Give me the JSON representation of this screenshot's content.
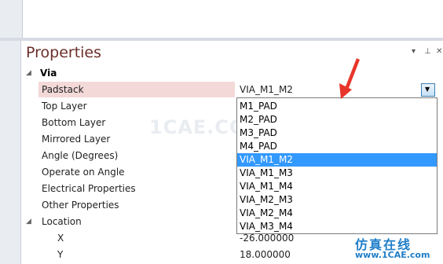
{
  "panel": {
    "title": "Properties"
  },
  "category": {
    "label": "Via"
  },
  "rows": [
    {
      "name": "Padstack",
      "value": "VIA_M1_M2"
    },
    {
      "name": "Top Layer"
    },
    {
      "name": "Bottom Layer"
    },
    {
      "name": "Mirrored Layer"
    },
    {
      "name": "Angle (Degrees)"
    },
    {
      "name": "Operate on Angle"
    },
    {
      "name": "Electrical Properties"
    },
    {
      "name": "Other Properties"
    },
    {
      "name": "Location"
    },
    {
      "name": "X",
      "value": "-26.000000"
    },
    {
      "name": "Y",
      "value": "18.000000"
    }
  ],
  "dropdown": {
    "selected": "VIA_M1_M2",
    "options": [
      "M1_PAD",
      "M2_PAD",
      "M3_PAD",
      "M4_PAD",
      "VIA_M1_M2",
      "VIA_M1_M3",
      "VIA_M1_M4",
      "VIA_M2_M3",
      "VIA_M2_M4",
      "VIA_M3_M4"
    ]
  },
  "watermark": "1CAE.COM",
  "branding": {
    "chinese": "仿真在线",
    "url": "www.1CAE.com"
  },
  "colors": {
    "accent": "#3399ff",
    "arrow": "#e8352b",
    "title": "#6b2e2a",
    "selected_row": "#f4d9d9"
  }
}
